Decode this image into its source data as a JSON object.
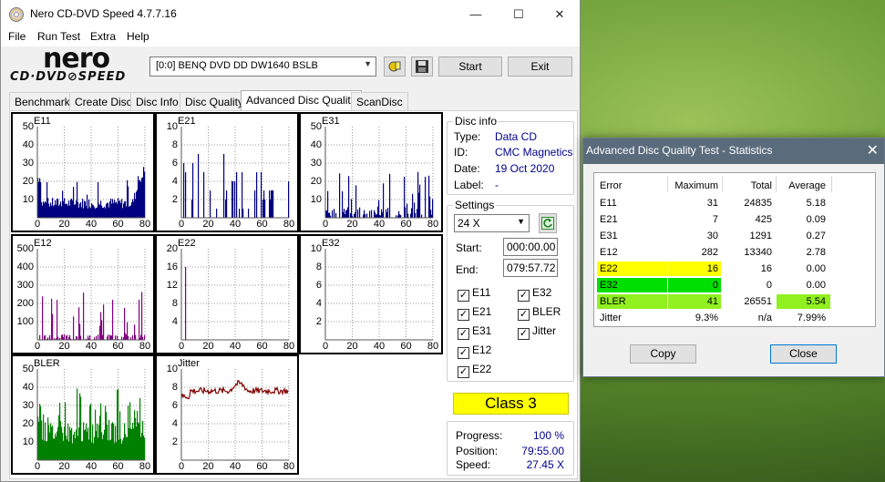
{
  "main_window": {
    "title": "Nero CD-DVD Speed 4.7.7.16",
    "caption": {
      "minimize": "—",
      "maximize": "☐",
      "close": "✕"
    },
    "menu": [
      "File",
      "Run Test",
      "Extra",
      "Help"
    ],
    "logo": {
      "nero": "nero",
      "cddvd": "CD·DVD⊘SPEED"
    },
    "drive": "[0:0]   BENQ DVD DD DW1640 BSLB",
    "buttons": {
      "start": "Start",
      "exit": "Exit"
    },
    "tabs": [
      "Benchmark",
      "Create Disc",
      "Disc Info",
      "Disc Quality",
      "Advanced Disc Quality",
      "ScanDisc"
    ],
    "active_tab": "Advanced Disc Quality"
  },
  "graphs": [
    {
      "id": "e11",
      "label": "E11",
      "color": "#000080",
      "yticks": [
        "50",
        "40",
        "30",
        "20",
        "10"
      ],
      "ymax": 50,
      "profile": "e11",
      "xticks": [
        "0",
        "20",
        "40",
        "60",
        "80"
      ]
    },
    {
      "id": "e21",
      "label": "E21",
      "color": "#000080",
      "yticks": [
        "10",
        "8",
        "6",
        "4",
        "2"
      ],
      "ymax": 10,
      "profile": "e21",
      "xticks": [
        "0",
        "20",
        "40",
        "60",
        "80"
      ]
    },
    {
      "id": "e31",
      "label": "E31",
      "color": "#000080",
      "yticks": [
        "50",
        "40",
        "30",
        "20",
        "10"
      ],
      "ymax": 50,
      "profile": "e31",
      "xticks": [
        "0",
        "20",
        "40",
        "60",
        "80"
      ]
    },
    {
      "id": "e12",
      "label": "E12",
      "color": "#800080",
      "yticks": [
        "500",
        "400",
        "300",
        "200",
        "100"
      ],
      "ymax": 500,
      "profile": "e12",
      "xticks": [
        "0",
        "20",
        "40",
        "60",
        "80"
      ]
    },
    {
      "id": "e22",
      "label": "E22",
      "color": "#800080",
      "yticks": [
        "20",
        "16",
        "12",
        "8",
        "4"
      ],
      "ymax": 20,
      "profile": "e22",
      "xticks": [
        "0",
        "20",
        "40",
        "60",
        "80"
      ]
    },
    {
      "id": "e32",
      "label": "E32",
      "color": "#800080",
      "yticks": [
        "10",
        "8",
        "6",
        "4",
        "2"
      ],
      "ymax": 10,
      "profile": "none",
      "xticks": [
        "0",
        "20",
        "40",
        "60",
        "80"
      ]
    },
    {
      "id": "bler",
      "label": "BLER",
      "color": "#008000",
      "yticks": [
        "50",
        "40",
        "30",
        "20",
        "10"
      ],
      "ymax": 50,
      "profile": "bler",
      "xticks": [
        "0",
        "20",
        "40",
        "60",
        "80"
      ]
    },
    {
      "id": "jitter",
      "label": "Jitter",
      "color": "#800000",
      "yticks": [
        "10",
        "8",
        "6",
        "4",
        "2"
      ],
      "ymax": 10,
      "profile": "jitter",
      "xticks": [
        "0",
        "20",
        "40",
        "60",
        "80"
      ]
    }
  ],
  "disc_info": {
    "legend": "Disc info",
    "type_label": "Type:",
    "type": "Data CD",
    "id_label": "ID:",
    "id": "CMC Magnetics",
    "date_label": "Date:",
    "date": "19 Oct 2020",
    "label_label": "Label:",
    "label": "-"
  },
  "settings": {
    "legend": "Settings",
    "speed": "24 X",
    "start_label": "Start:",
    "start": "000:00.00",
    "end_label": "End:",
    "end": "079:57.72",
    "checks": [
      "E11",
      "E32",
      "E21",
      "BLER",
      "E31",
      "Jitter",
      "E12",
      "E22"
    ],
    "check_mark": "✓"
  },
  "class_result": "Class 3",
  "progress": {
    "progress_label": "Progress:",
    "progress": "100 %",
    "position_label": "Position:",
    "position": "79:55.00",
    "speed_label": "Speed:",
    "speed": "27.45 X"
  },
  "stats": {
    "title": "Advanced Disc Quality Test - Statistics",
    "close": "✕",
    "headers": [
      "Error",
      "Maximum",
      "Total",
      "Average"
    ],
    "rows": [
      {
        "error": "E11",
        "maximum": "31",
        "total": "24835",
        "average": "5.18"
      },
      {
        "error": "E21",
        "maximum": "7",
        "total": "425",
        "average": "0.09"
      },
      {
        "error": "E31",
        "maximum": "30",
        "total": "1291",
        "average": "0.27"
      },
      {
        "error": "E12",
        "maximum": "282",
        "total": "13340",
        "average": "2.78"
      },
      {
        "error": "E22",
        "maximum": "16",
        "total": "16",
        "average": "0.00"
      },
      {
        "error": "E32",
        "maximum": "0",
        "total": "0",
        "average": "0.00"
      },
      {
        "error": "BLER",
        "maximum": "41",
        "total": "26551",
        "average": "5.54"
      },
      {
        "error": "Jitter",
        "maximum": "9.3%",
        "total": "n/a",
        "average": "7.99%"
      }
    ],
    "highlight_colors": {
      "yellow": "#ffff00",
      "green": "#00e000",
      "lime": "#90f020"
    },
    "buttons": {
      "copy": "Copy",
      "close": "Close"
    }
  }
}
